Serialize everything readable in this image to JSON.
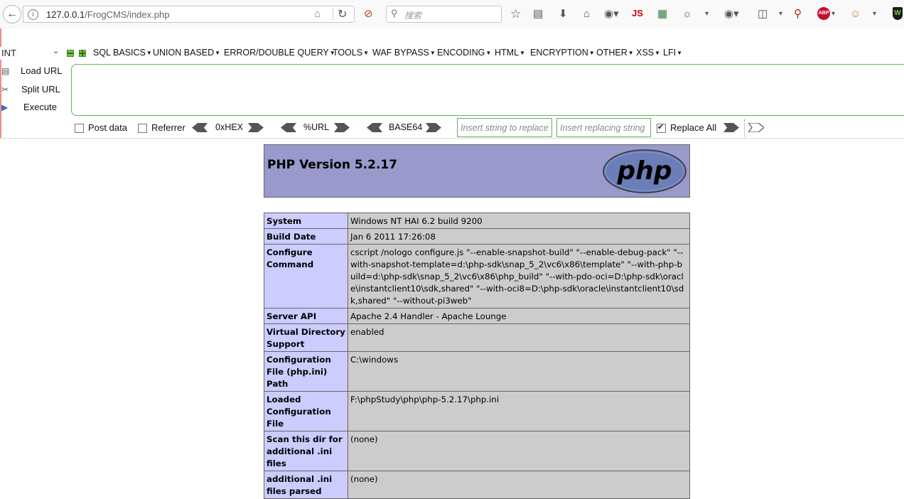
{
  "browser": {
    "url_host": "127.0.0.1",
    "url_path": "/FrogCMS/index.php",
    "search_placeholder": "搜索",
    "js_badge": "JS",
    "abp_badge": "ABP"
  },
  "hackbar": {
    "type_select": "INT",
    "menus": [
      "SQL BASICS",
      "UNION BASED",
      "ERROR/DOUBLE QUERY",
      "TOOLS",
      "WAF BYPASS",
      "ENCODING",
      "HTML",
      "ENCRYPTION",
      "OTHER",
      "XSS",
      "LFI"
    ],
    "side_buttons": {
      "load_url": "Load URL",
      "split_url": "Split URL",
      "execute": "Execute"
    },
    "url_value": "",
    "options": {
      "post_data": "Post data",
      "referrer": "Referrer",
      "hex": "0xHEX",
      "url": "%URL",
      "base64": "BASE64",
      "replace_placeholder": "Insert string to replace",
      "replacing_placeholder": "Insert replacing string",
      "replace_all": "Replace All",
      "post_data_checked": false,
      "referrer_checked": false,
      "replace_all_checked": true
    }
  },
  "phpinfo": {
    "title": "PHP Version 5.2.17",
    "logo_text": "php",
    "rows": [
      {
        "key": "System",
        "value": "Windows NT HAI 6.2 build 9200"
      },
      {
        "key": "Build Date",
        "value": "Jan 6 2011 17:26:08"
      },
      {
        "key": "Configure Command",
        "value": "cscript /nologo configure.js \"--enable-snapshot-build\" \"--enable-debug-pack\" \"--with-snapshot-template=d:\\php-sdk\\snap_5_2\\vc6\\x86\\template\" \"--with-php-build=d:\\php-sdk\\snap_5_2\\vc6\\x86\\php_build\" \"--with-pdo-oci=D:\\php-sdk\\oracle\\instantclient10\\sdk,shared\" \"--with-oci8=D:\\php-sdk\\oracle\\instantclient10\\sdk,shared\" \"--without-pi3web\""
      },
      {
        "key": "Server API",
        "value": "Apache 2.4 Handler - Apache Lounge"
      },
      {
        "key": "Virtual Directory Support",
        "value": "enabled"
      },
      {
        "key": "Configuration File (php.ini) Path",
        "value": "C:\\windows"
      },
      {
        "key": "Loaded Configuration File",
        "value": "F:\\phpStudy\\php\\php-5.2.17\\php.ini"
      },
      {
        "key": "Scan this dir for additional .ini files",
        "value": "(none)"
      },
      {
        "key": "additional .ini files parsed",
        "value": "(none)"
      }
    ]
  },
  "colors": {
    "php_header": "#9999cc",
    "key_cell": "#ccccff",
    "value_cell": "#cccccc",
    "hackbar_border": "#62b25b"
  }
}
